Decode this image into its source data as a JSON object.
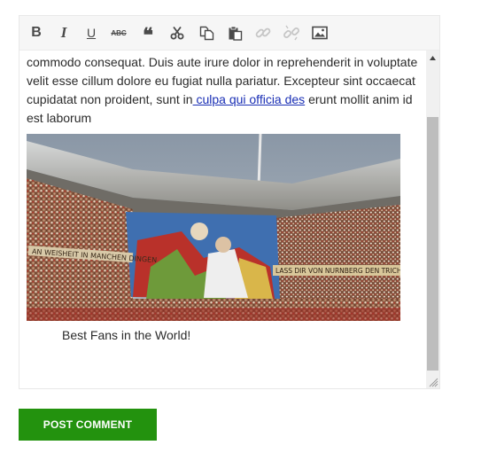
{
  "toolbar": {
    "items": [
      {
        "icon": "bold-icon",
        "glyph": "B"
      },
      {
        "icon": "italic-icon",
        "glyph": "I"
      },
      {
        "icon": "underline-icon",
        "glyph": "U"
      },
      {
        "icon": "strikethrough-icon",
        "glyph": "ABC"
      },
      {
        "icon": "blockquote-icon",
        "glyph": "❝"
      },
      {
        "icon": "cut-icon"
      },
      {
        "icon": "copy-icon"
      },
      {
        "icon": "paste-icon"
      },
      {
        "icon": "link-icon",
        "disabled": true
      },
      {
        "icon": "unlink-icon",
        "disabled": true
      },
      {
        "icon": "image-icon"
      }
    ]
  },
  "editor": {
    "text_before_link": "commodo consequat. Duis aute irure dolor in reprehenderit in voluptate velit esse cillum dolore eu fugiat nulla pariatur. Excepteur sint occaecat cupidatat non proident, sunt in",
    "link_text": " culpa qui officia des",
    "text_after_link": "erunt mollit anim id est laborum",
    "image_banner_left": "AN WEISHEIT IN MANCHEN DINGEN",
    "image_banner_right": "LASS DIR VON NURNBERG DEN TRICHTE",
    "caption": "Best Fans in the World!"
  },
  "submit": {
    "label": "POST COMMENT",
    "color": "#23920e"
  }
}
